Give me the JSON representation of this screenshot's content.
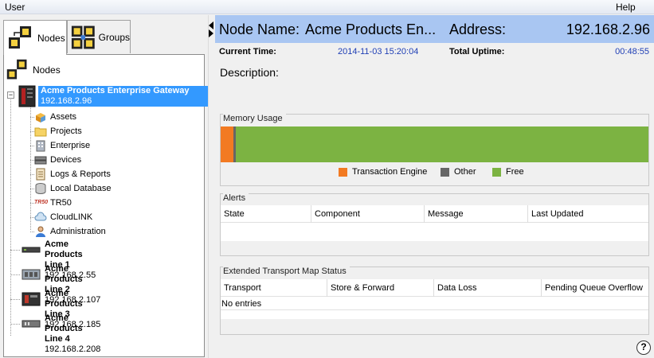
{
  "menu": {
    "user": "User",
    "help": "Help"
  },
  "tabs": [
    {
      "label": "Nodes",
      "icon": "nodes-icon"
    },
    {
      "label": "Groups",
      "icon": "groups-icon"
    }
  ],
  "tree": {
    "root": "Nodes",
    "gateway": {
      "name": "Acme Products Enterprise Gateway",
      "ip": "192.168.2.96"
    },
    "children": [
      {
        "label": "Assets",
        "icon": "assets-icon"
      },
      {
        "label": "Projects",
        "icon": "folder-icon"
      },
      {
        "label": "Enterprise",
        "icon": "enterprise-icon"
      },
      {
        "label": "Devices",
        "icon": "devices-icon"
      },
      {
        "label": "Logs & Reports",
        "icon": "logs-icon"
      },
      {
        "label": "Local Database",
        "icon": "database-icon"
      },
      {
        "label": "TR50",
        "icon": "tr50-icon",
        "badge": "TR50"
      },
      {
        "label": "CloudLINK",
        "icon": "cloud-icon"
      },
      {
        "label": "Administration",
        "icon": "admin-icon"
      }
    ],
    "lines": [
      {
        "name": "Acme Products Line 1",
        "ip": "192.168.2.55"
      },
      {
        "name": "Acme Products Line 2",
        "ip": "192.168.2.107"
      },
      {
        "name": "Acme Products Line 3",
        "ip": "192.168.2.185"
      },
      {
        "name": "Acme Products Line 4",
        "ip": "192.168.2.208"
      }
    ]
  },
  "detail": {
    "node_name_label": "Node Name:",
    "node_name_value": "Acme Products En...",
    "address_label": "Address:",
    "address_value": "192.168.2.96",
    "current_time_label": "Current Time:",
    "current_time_value": "2014-11-03 15:20:04",
    "uptime_label": "Total Uptime:",
    "uptime_value": "00:48:55",
    "description_label": "Description:"
  },
  "memory": {
    "title": "Memory Usage",
    "transaction_engine_fraction": 0.03,
    "other_fraction": 0.006,
    "free_fraction": 0.964,
    "legend": [
      {
        "label": "Transaction Engine",
        "color": "#f27a22"
      },
      {
        "label": "Other",
        "color": "#666666"
      },
      {
        "label": "Free",
        "color": "#7cb342"
      }
    ]
  },
  "alerts": {
    "title": "Alerts",
    "columns": [
      "State",
      "Component",
      "Message",
      "Last Updated"
    ]
  },
  "transport": {
    "title": "Extended Transport Map Status",
    "columns": [
      "Transport",
      "Store & Forward",
      "Data Loss",
      "Pending Queue Overflow"
    ],
    "empty_text": "No entries"
  },
  "help_glyph": "?"
}
